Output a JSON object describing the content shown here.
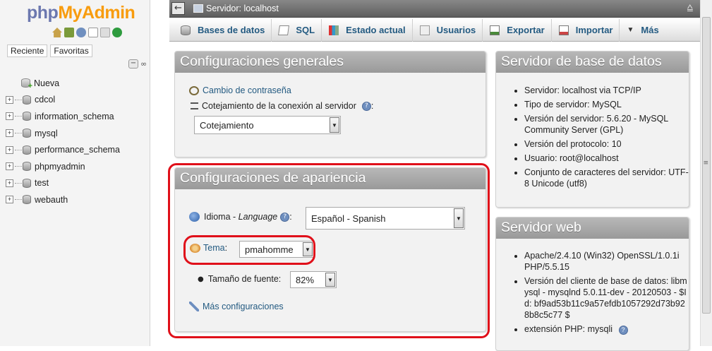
{
  "nav": {
    "logo_php": "php",
    "logo_myadmin": "MyAdmin",
    "tabs": [
      "Reciente",
      "Favoritas"
    ],
    "new_label": "Nueva",
    "databases": [
      "cdcol",
      "information_schema",
      "mysql",
      "performance_schema",
      "phpmyadmin",
      "test",
      "webauth"
    ]
  },
  "topbar": {
    "server": "Servidor: localhost"
  },
  "menu": {
    "items": [
      "Bases de datos",
      "SQL",
      "Estado actual",
      "Usuarios",
      "Exportar",
      "Importar",
      "Más"
    ]
  },
  "general": {
    "title": "Configuraciones generales",
    "change_password": "Cambio de contraseña",
    "collation_label": "Cotejamiento de la conexión al servidor",
    "collation_colon": ":",
    "collation_value": "Cotejamiento"
  },
  "appearance": {
    "title": "Configuraciones de apariencia",
    "language_label": "Idioma",
    "language_sep": " - ",
    "language_en": "Language",
    "language_value": "Español - Spanish",
    "theme_label": "Tema",
    "theme_colon": ":",
    "theme_value": "pmahomme",
    "font_size_label": "Tamaño de fuente:",
    "font_size_value": "82%",
    "more_settings": "Más configuraciones"
  },
  "db_server": {
    "title": "Servidor de base de datos",
    "items": [
      "Servidor: localhost via TCP/IP",
      "Tipo de servidor: MySQL",
      "Versión del servidor: 5.6.20 - MySQL Community Server (GPL)",
      "Versión del protocolo: 10",
      "Usuario: root@localhost",
      "Conjunto de caracteres del servidor: UTF-8 Unicode (utf8)"
    ]
  },
  "web_server": {
    "title": "Servidor web",
    "items": [
      "Apache/2.4.10 (Win32) OpenSSL/1.0.1i PHP/5.5.15",
      "Versión del cliente de base de datos: libmysql - mysqlnd 5.0.11-dev - 20120503 - $Id: bf9ad53b11c9a57efdb1057292d73b928b8c5c77 $",
      "extensión PHP: mysqli"
    ]
  },
  "colors": {
    "link": "#235a81",
    "highlight": "#e0101a",
    "logo_php": "#6c78af",
    "logo_myadmin": "#f89c0e"
  }
}
